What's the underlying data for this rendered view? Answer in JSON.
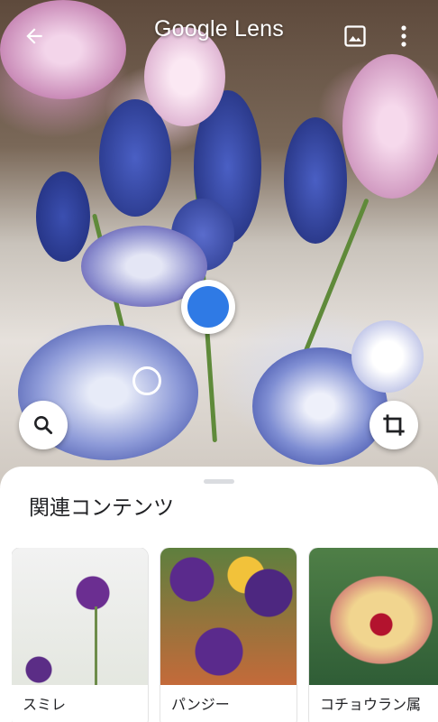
{
  "header": {
    "title": "Google Lens",
    "back_icon": "arrow-back-icon",
    "gallery_icon": "image-gallery-icon",
    "more_icon": "more-vert-icon"
  },
  "viewfinder": {
    "search_icon": "search-icon",
    "crop_icon": "crop-icon",
    "accent_color": "#2f7ae5"
  },
  "sheet": {
    "title": "関連コンテンツ",
    "results": [
      {
        "label": "スミレ"
      },
      {
        "label": "パンジー"
      },
      {
        "label": "コチョウラン属"
      }
    ]
  }
}
